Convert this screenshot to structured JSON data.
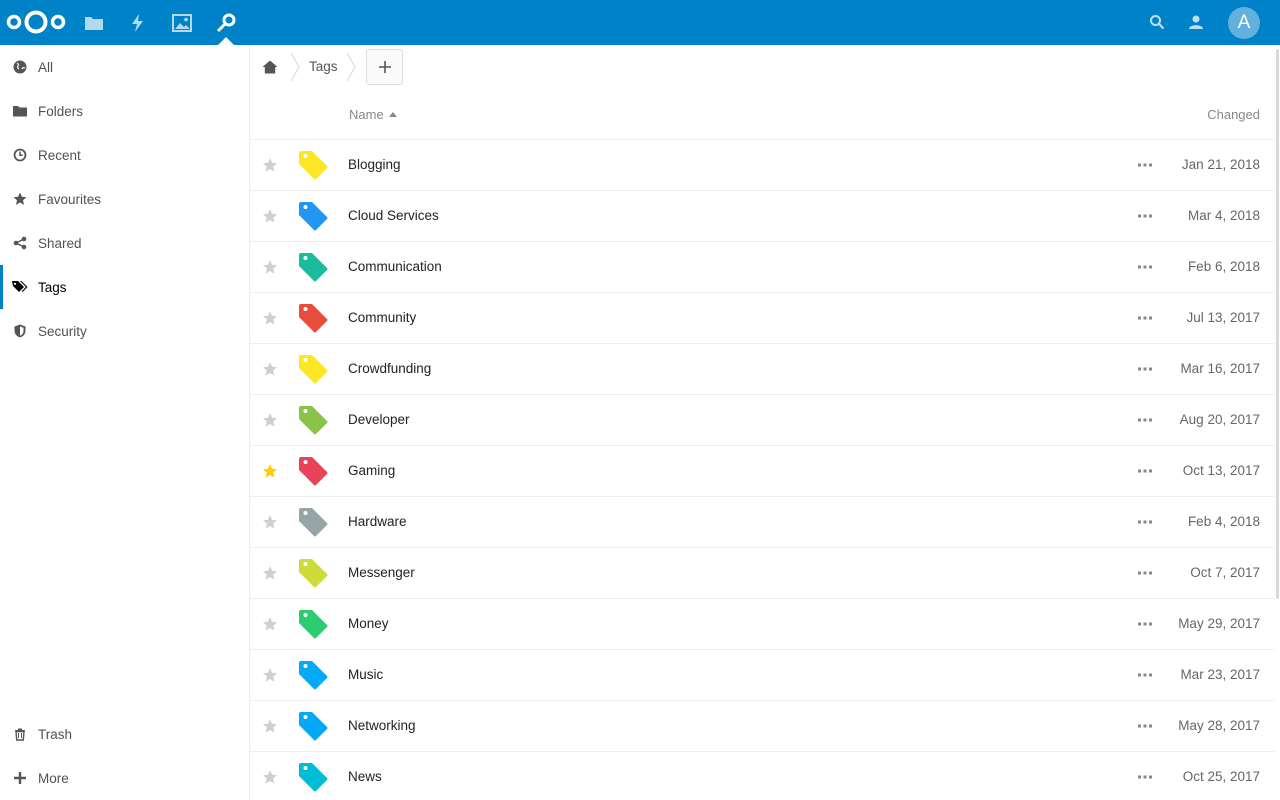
{
  "colors": {
    "brand": "#0082c9",
    "star_active": "#ffcc00",
    "star_inactive": "#cfcfcf"
  },
  "header": {
    "apps": [
      "files-icon",
      "activity-icon",
      "gallery-icon",
      "passwords-icon"
    ],
    "avatar_letter": "A"
  },
  "sidebar": {
    "items": [
      {
        "label": "All",
        "icon": "globe-icon"
      },
      {
        "label": "Folders",
        "icon": "folder-icon"
      },
      {
        "label": "Recent",
        "icon": "clock-icon"
      },
      {
        "label": "Favourites",
        "icon": "star-icon"
      },
      {
        "label": "Shared",
        "icon": "share-icon"
      },
      {
        "label": "Tags",
        "icon": "tags-icon",
        "active": true
      },
      {
        "label": "Security",
        "icon": "shield-icon"
      }
    ],
    "bottom": [
      {
        "label": "Trash",
        "icon": "trash-icon"
      },
      {
        "label": "More",
        "icon": "plus-icon"
      }
    ]
  },
  "breadcrumb": {
    "current": "Tags"
  },
  "table": {
    "col_name": "Name",
    "col_changed": "Changed",
    "rows": [
      {
        "name": "Blogging",
        "date": "Jan 21, 2018",
        "color": "#fde725",
        "fav": false
      },
      {
        "name": "Cloud Services",
        "date": "Mar 4, 2018",
        "color": "#2196f3",
        "fav": false
      },
      {
        "name": "Communication",
        "date": "Feb 6, 2018",
        "color": "#1abc9c",
        "fav": false
      },
      {
        "name": "Community",
        "date": "Jul 13, 2017",
        "color": "#e74c3c",
        "fav": false
      },
      {
        "name": "Crowdfunding",
        "date": "Mar 16, 2017",
        "color": "#fde725",
        "fav": false
      },
      {
        "name": "Developer",
        "date": "Aug 20, 2017",
        "color": "#8bc34a",
        "fav": false
      },
      {
        "name": "Gaming",
        "date": "Oct 13, 2017",
        "color": "#e84358",
        "fav": true
      },
      {
        "name": "Hardware",
        "date": "Feb 4, 2018",
        "color": "#95a5a6",
        "fav": false
      },
      {
        "name": "Messenger",
        "date": "Oct 7, 2017",
        "color": "#cddc39",
        "fav": false
      },
      {
        "name": "Money",
        "date": "May 29, 2017",
        "color": "#2ecc71",
        "fav": false
      },
      {
        "name": "Music",
        "date": "Mar 23, 2017",
        "color": "#03a9f4",
        "fav": false
      },
      {
        "name": "Networking",
        "date": "May 28, 2017",
        "color": "#03a9f4",
        "fav": false
      },
      {
        "name": "News",
        "date": "Oct 25, 2017",
        "color": "#00bcd4",
        "fav": false
      }
    ]
  }
}
